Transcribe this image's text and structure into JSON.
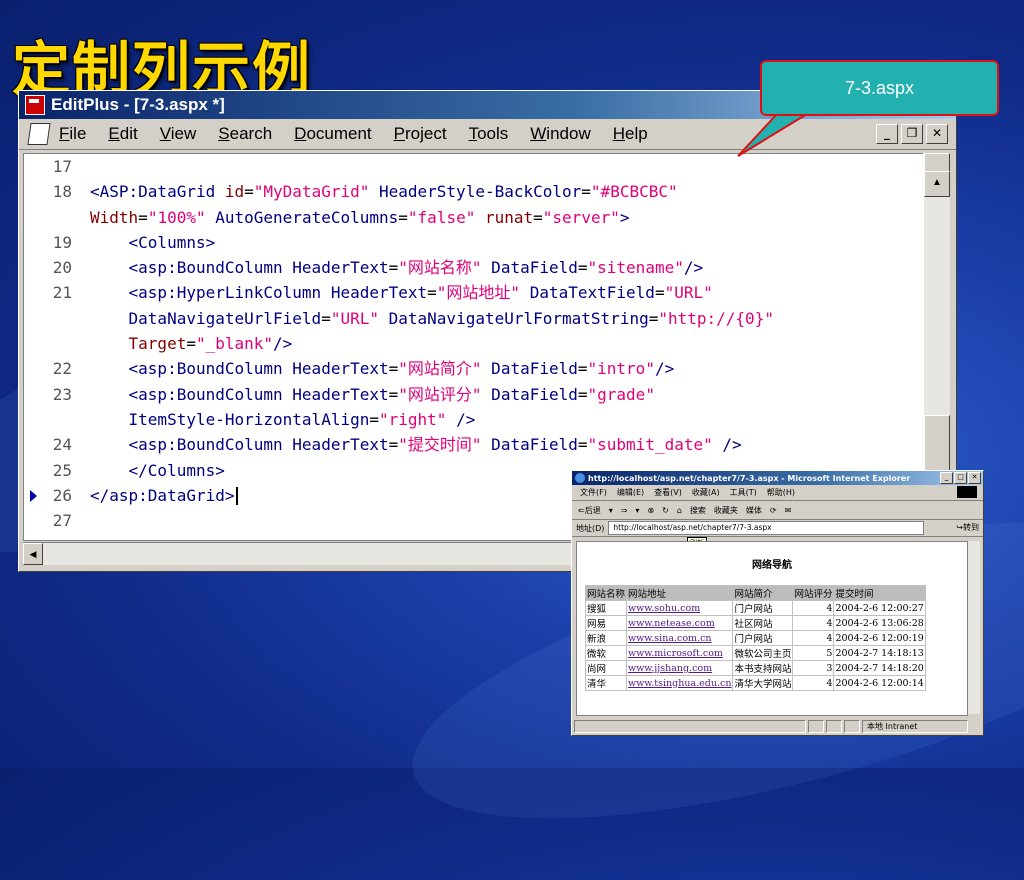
{
  "slide": {
    "title": "定制列示例"
  },
  "callout": {
    "text": "7-3.aspx"
  },
  "editplus": {
    "title": "EditPlus - [7-3.aspx *]",
    "menu": [
      {
        "label": "File",
        "key": "F",
        "rest": "ile"
      },
      {
        "label": "Edit",
        "key": "E",
        "rest": "dit"
      },
      {
        "label": "View",
        "key": "V",
        "rest": "iew"
      },
      {
        "label": "Search",
        "key": "S",
        "rest": "earch"
      },
      {
        "label": "Document",
        "key": "D",
        "rest": "ocument"
      },
      {
        "label": "Project",
        "key": "P",
        "rest": "roject"
      },
      {
        "label": "Tools",
        "key": "T",
        "rest": "ools"
      },
      {
        "label": "Window",
        "key": "W",
        "rest": "indow"
      },
      {
        "label": "Help",
        "key": "H",
        "rest": "elp"
      }
    ],
    "lines": [
      {
        "num": "17",
        "segments": []
      },
      {
        "num": "18",
        "segments": [
          {
            "t": "<ASP:DataGrid ",
            "c": "tg"
          },
          {
            "t": "id",
            "c": "at"
          },
          {
            "t": "=",
            "c": "pl"
          },
          {
            "t": "\"MyDataGrid\"",
            "c": "st"
          },
          {
            "t": " HeaderStyle-BackColor",
            "c": "tg"
          },
          {
            "t": "=",
            "c": "pl"
          },
          {
            "t": "\"#BCBCBC\"",
            "c": "st"
          }
        ]
      },
      {
        "num": "",
        "segments": [
          {
            "t": "Width",
            "c": "at"
          },
          {
            "t": "=",
            "c": "pl"
          },
          {
            "t": "\"100%\"",
            "c": "st"
          },
          {
            "t": " AutoGenerateColumns",
            "c": "tg"
          },
          {
            "t": "=",
            "c": "pl"
          },
          {
            "t": "\"false\"",
            "c": "st"
          },
          {
            "t": " runat",
            "c": "at"
          },
          {
            "t": "=",
            "c": "pl"
          },
          {
            "t": "\"server\"",
            "c": "st"
          },
          {
            "t": ">",
            "c": "tg"
          }
        ]
      },
      {
        "num": "19",
        "segments": [
          {
            "t": "    <Columns>",
            "c": "tg"
          }
        ]
      },
      {
        "num": "20",
        "segments": [
          {
            "t": "    <asp:BoundColumn HeaderText",
            "c": "tg"
          },
          {
            "t": "=",
            "c": "pl"
          },
          {
            "t": "\"网站名称\"",
            "c": "st"
          },
          {
            "t": " DataField",
            "c": "tg"
          },
          {
            "t": "=",
            "c": "pl"
          },
          {
            "t": "\"sitename\"",
            "c": "st"
          },
          {
            "t": "/>",
            "c": "tg"
          }
        ]
      },
      {
        "num": "21",
        "segments": [
          {
            "t": "    <asp:HyperLinkColumn HeaderText",
            "c": "tg"
          },
          {
            "t": "=",
            "c": "pl"
          },
          {
            "t": "\"网站地址\"",
            "c": "st"
          },
          {
            "t": " DataTextField",
            "c": "tg"
          },
          {
            "t": "=",
            "c": "pl"
          },
          {
            "t": "\"URL\"",
            "c": "st"
          }
        ]
      },
      {
        "num": "",
        "segments": [
          {
            "t": "    DataNavigateUrlField",
            "c": "tg"
          },
          {
            "t": "=",
            "c": "pl"
          },
          {
            "t": "\"URL\"",
            "c": "st"
          },
          {
            "t": " DataNavigateUrlFormatString",
            "c": "tg"
          },
          {
            "t": "=",
            "c": "pl"
          },
          {
            "t": "\"http://{0}\"",
            "c": "st"
          }
        ]
      },
      {
        "num": "",
        "segments": [
          {
            "t": "    Target",
            "c": "at"
          },
          {
            "t": "=",
            "c": "pl"
          },
          {
            "t": "\"_blank\"",
            "c": "st"
          },
          {
            "t": "/>",
            "c": "tg"
          }
        ]
      },
      {
        "num": "22",
        "segments": [
          {
            "t": "    <asp:BoundColumn HeaderText",
            "c": "tg"
          },
          {
            "t": "=",
            "c": "pl"
          },
          {
            "t": "\"网站简介\"",
            "c": "st"
          },
          {
            "t": " DataField",
            "c": "tg"
          },
          {
            "t": "=",
            "c": "pl"
          },
          {
            "t": "\"intro\"",
            "c": "st"
          },
          {
            "t": "/>",
            "c": "tg"
          }
        ]
      },
      {
        "num": "23",
        "segments": [
          {
            "t": "    <asp:BoundColumn HeaderText",
            "c": "tg"
          },
          {
            "t": "=",
            "c": "pl"
          },
          {
            "t": "\"网站评分\"",
            "c": "st"
          },
          {
            "t": " DataField",
            "c": "tg"
          },
          {
            "t": "=",
            "c": "pl"
          },
          {
            "t": "\"grade\"",
            "c": "st"
          }
        ]
      },
      {
        "num": "",
        "segments": [
          {
            "t": "    ItemStyle-HorizontalAlign",
            "c": "tg"
          },
          {
            "t": "=",
            "c": "pl"
          },
          {
            "t": "\"right\"",
            "c": "st"
          },
          {
            "t": " />",
            "c": "tg"
          }
        ]
      },
      {
        "num": "24",
        "segments": [
          {
            "t": "    <asp:BoundColumn HeaderText",
            "c": "tg"
          },
          {
            "t": "=",
            "c": "pl"
          },
          {
            "t": "\"提交时间\"",
            "c": "st"
          },
          {
            "t": " DataField",
            "c": "tg"
          },
          {
            "t": "=",
            "c": "pl"
          },
          {
            "t": "\"submit_date\"",
            "c": "st"
          },
          {
            "t": " />",
            "c": "tg"
          }
        ]
      },
      {
        "num": "25",
        "segments": [
          {
            "t": "    </Columns>",
            "c": "tg"
          }
        ]
      },
      {
        "num": "26",
        "marker": true,
        "caret": true,
        "segments": [
          {
            "t": "</asp:DataGrid>",
            "c": "tg"
          }
        ]
      },
      {
        "num": "27",
        "segments": []
      }
    ]
  },
  "browser": {
    "title": "http://localhost/asp.net/chapter7/7-3.aspx - Microsoft Internet Explorer",
    "menu": [
      "文件(F)",
      "编辑(E)",
      "查看(V)",
      "收藏(A)",
      "工具(T)",
      "帮助(H)"
    ],
    "toolbar": [
      "⇐后退",
      "▾",
      "⇒",
      "▾",
      "⊗",
      "↻",
      "⌂",
      "搜索",
      "收藏夹",
      "媒体",
      "⟳",
      "✉"
    ],
    "address_label": "地址(D)",
    "address": "http://localhost/asp.net/chapter7/7-3.aspx",
    "go_label": "转到",
    "tooltip": "刷新",
    "page_title": "网络导航",
    "columns": [
      "网站名称",
      "网站地址",
      "网站简介",
      "网站评分",
      "提交时间"
    ],
    "rows": [
      [
        "搜狐",
        "www.sohu.com",
        "门户网站",
        "4",
        "2004-2-6 12:00:27"
      ],
      [
        "网易",
        "www.netease.com",
        "社区网站",
        "4",
        "2004-2-6 13:06:28"
      ],
      [
        "新浪",
        "www.sina.com.cn",
        "门户网站",
        "4",
        "2004-2-6 12:00:19"
      ],
      [
        "微软",
        "www.microsoft.com",
        "微软公司主页",
        "5",
        "2004-2-7 14:18:13"
      ],
      [
        "尚网",
        "www.jjshang.com",
        "本书支持网站",
        "3",
        "2004-2-7 14:18:20"
      ],
      [
        "清华",
        "www.tsinghua.edu.cn",
        "清华大学网站",
        "4",
        "2004-2-6 12:00:14"
      ]
    ],
    "status_zone": "本地 Intranet"
  }
}
